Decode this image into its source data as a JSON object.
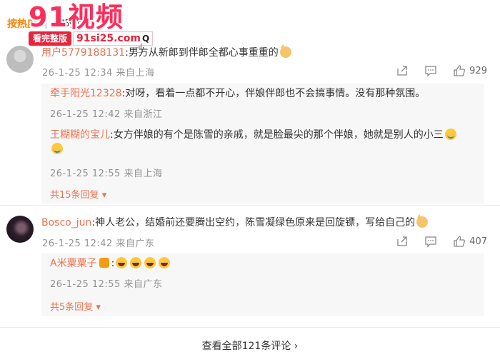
{
  "sort": {
    "hot": "按热度",
    "time": "按时间"
  },
  "watermark": {
    "logo": "91视频",
    "button": "看完整版",
    "url": "91si25.com",
    "search_glyph": "Q"
  },
  "comments": [
    {
      "user": "用户5779188131",
      "text": "男方从新郎到伴郎全都心事重重的",
      "meta": "26-1-25 12:34 来自上海",
      "likes": "929",
      "replies": [
        {
          "user": "牵手阳光12328",
          "text": "对呀，看着一点都不开心，伴娘伴郎也不会搞事情。没有那种氛围。",
          "meta": "26-1-25 12:42 来自浙江"
        },
        {
          "user": "王糊糊的宝儿",
          "text": "女方伴娘的有个是陈雪的亲戚，就是脸最尖的那个伴娘，她就是别人的小三",
          "meta": "26-1-25 12:55 来自上海"
        }
      ],
      "more": "共15条回复"
    },
    {
      "user": "Bosco_jun",
      "text": "神人老公，结婚前还要腾出空约，陈雪凝绿色原来是回旋镖，写给自己的",
      "meta": "26-1-25 12:42 来自广东",
      "likes": "407",
      "replies": [
        {
          "user": "A米粟粟子",
          "text": "",
          "meta": "26-1-25 12:55 来自广东"
        }
      ],
      "more": "共5条回复"
    }
  ],
  "see_all": "查看全部121条评论"
}
